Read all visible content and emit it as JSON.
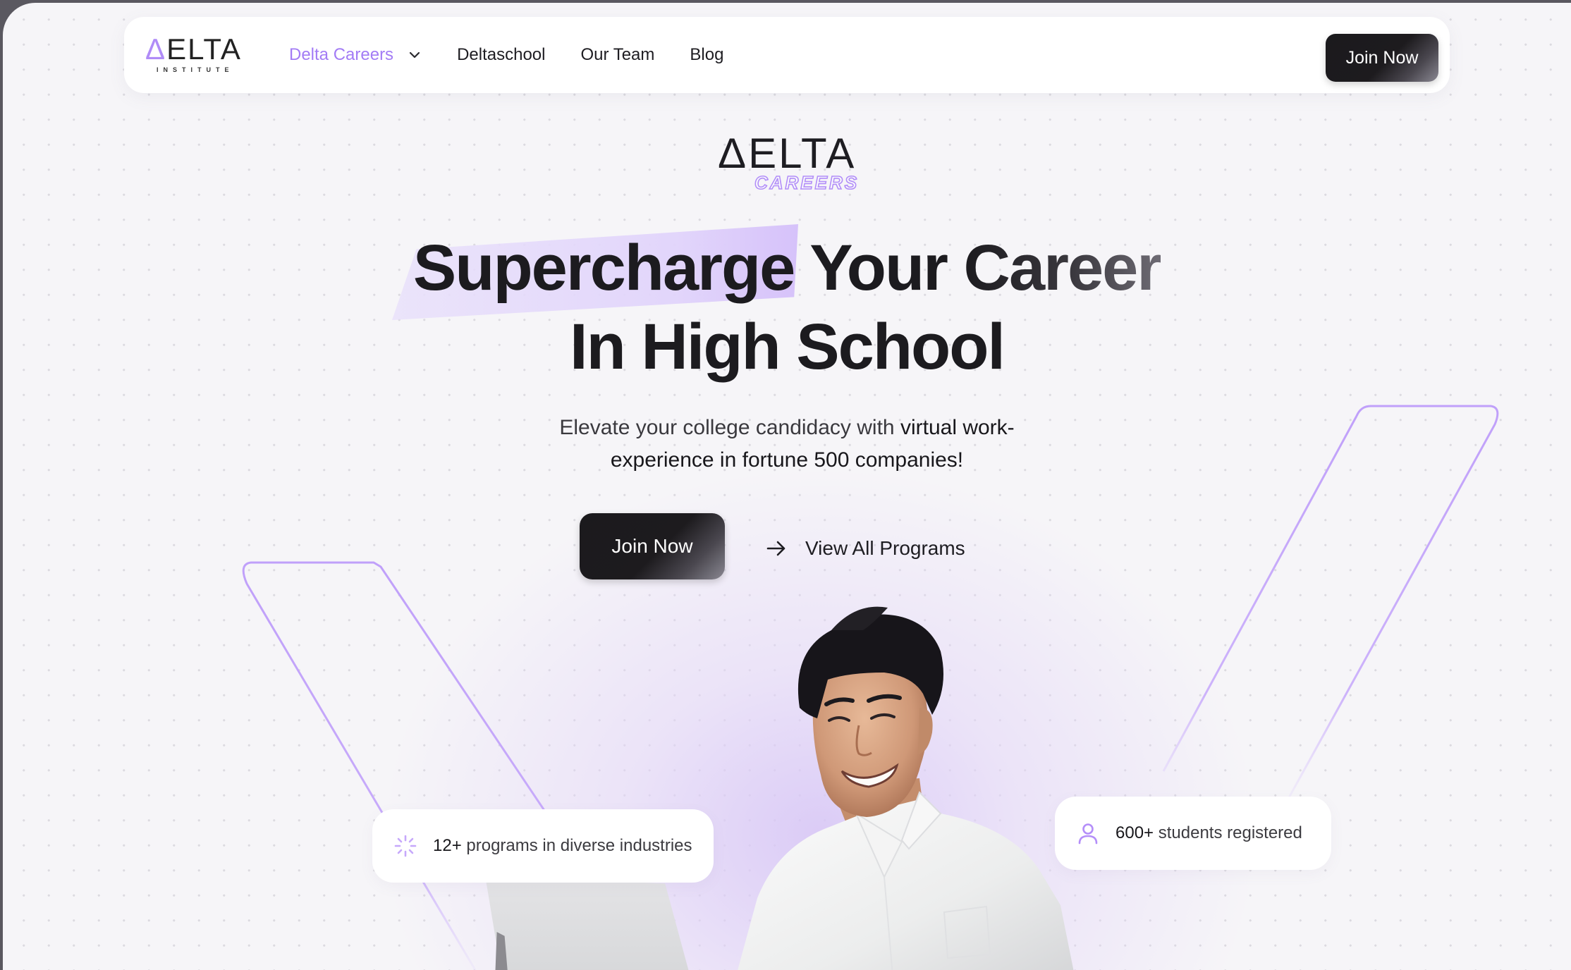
{
  "nav": {
    "logo": {
      "word": "ELTA",
      "triangle": "Δ",
      "sub": "INSTITUTE"
    },
    "links": [
      {
        "label": "Delta Careers",
        "active": true,
        "has_dropdown": true
      },
      {
        "label": "Deltaschool",
        "active": false
      },
      {
        "label": "Our Team",
        "active": false
      },
      {
        "label": "Blog",
        "active": false
      }
    ],
    "join_label": "Join Now"
  },
  "hero": {
    "logo": {
      "triangle": "Δ",
      "word": "ELTA",
      "sub": "CAREERS"
    },
    "headline": {
      "highlight": "Supercharge",
      "line1_rest_a": " Your ",
      "line1_rest_b": "Career",
      "line2": "In High School"
    },
    "subtitle": {
      "line1_plain": "Elevate your college candidacy with ",
      "line1_bold": "virtual work-",
      "line2_bold": "experience in fortune 500 companies!"
    },
    "join_label": "Join Now",
    "view_all_label": "View All Programs"
  },
  "badges": {
    "programs": {
      "count": "12+",
      "text": " programs in diverse industries",
      "icon": "loader-sparkle-icon"
    },
    "students": {
      "count": "600+",
      "text": " students registered",
      "icon": "user-icon"
    }
  },
  "colors": {
    "accent": "#a37cf5",
    "accent_light": "#d9c7fb",
    "dark": "#1c1b1f",
    "background": "#f6f5f8",
    "frame": "#5a5860"
  }
}
